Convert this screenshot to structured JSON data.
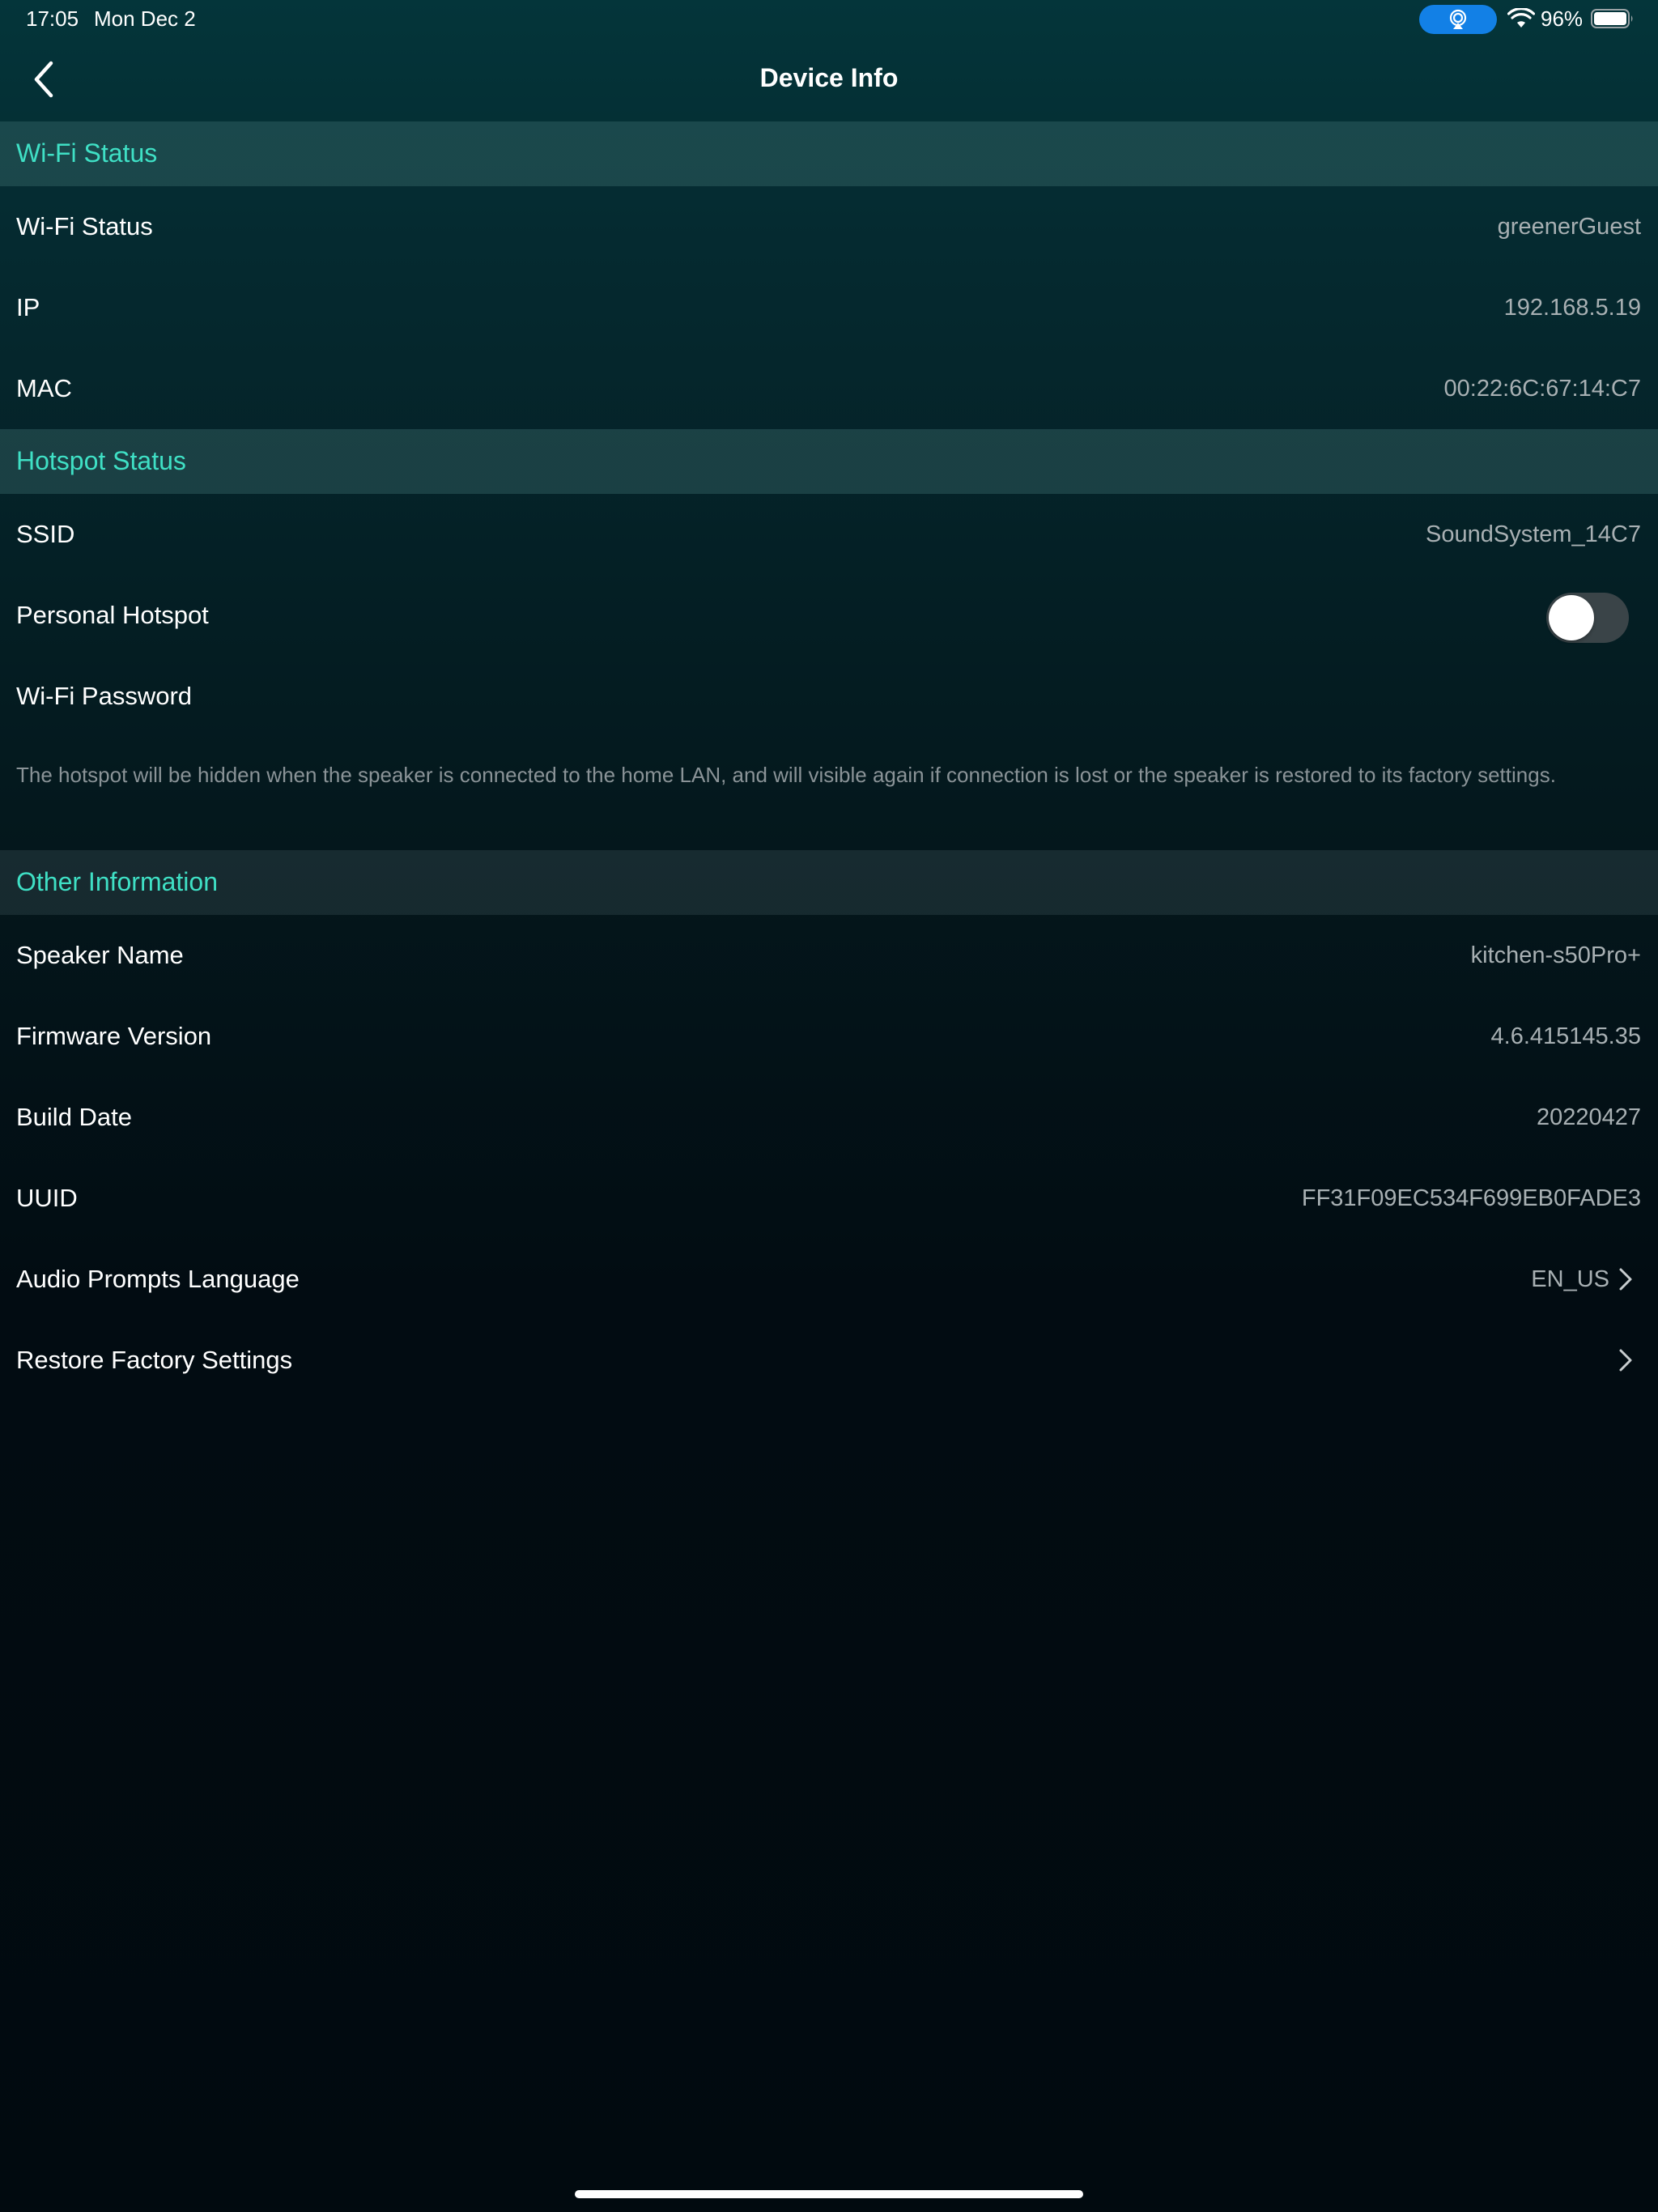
{
  "status_bar": {
    "time": "17:05",
    "date": "Mon Dec 2",
    "battery": "96%"
  },
  "nav": {
    "title": "Device Info"
  },
  "sections": {
    "wifi": {
      "header": "Wi-Fi Status",
      "rows": [
        {
          "label": "Wi-Fi Status",
          "value": "greenerGuest"
        },
        {
          "label": "IP",
          "value": "192.168.5.19"
        },
        {
          "label": "MAC",
          "value": "00:22:6C:67:14:C7"
        }
      ]
    },
    "hotspot": {
      "header": "Hotspot Status",
      "ssid_label": "SSID",
      "ssid_value": "SoundSystem_14C7",
      "personal_hotspot_label": "Personal Hotspot",
      "personal_hotspot_on": false,
      "password_label": "Wi-Fi Password",
      "note": "The hotspot will be hidden when the speaker is connected to the home LAN, and will visible again if connection is lost or the speaker is restored to its factory settings."
    },
    "other": {
      "header": "Other Information",
      "rows": [
        {
          "label": "Speaker Name",
          "value": "kitchen-s50Pro+"
        },
        {
          "label": "Firmware Version",
          "value": "4.6.415145.35"
        },
        {
          "label": "Build Date",
          "value": "20220427"
        },
        {
          "label": "UUID",
          "value": "FF31F09EC534F699EB0FADE3"
        }
      ],
      "audio_prompts_label": "Audio Prompts Language",
      "audio_prompts_value": "EN_US",
      "restore_label": "Restore Factory Settings"
    }
  },
  "colors": {
    "accent": "#3fe0c5",
    "airplay": "#1280e6"
  }
}
